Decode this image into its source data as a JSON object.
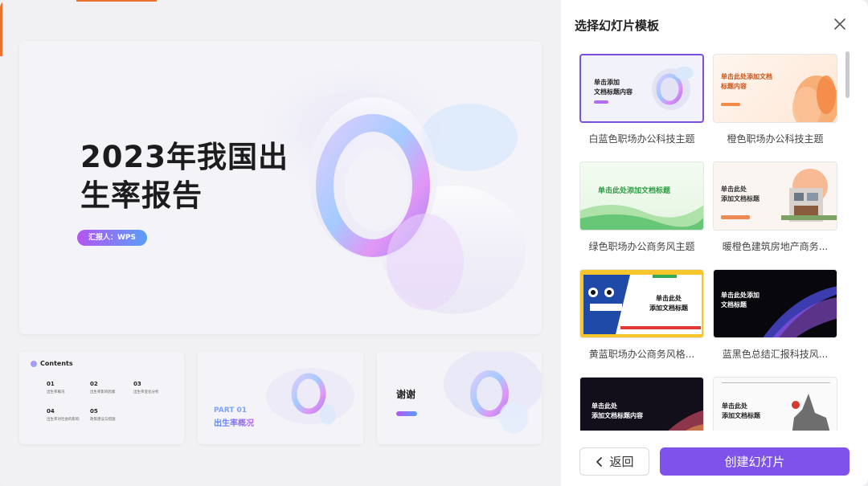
{
  "preview": {
    "main_title_line1": "2023年我国出",
    "main_title_line2": "生率报告",
    "reporter": "汇报人：WPS",
    "contents_title": "Contents",
    "contents_items": [
      {
        "num": "01",
        "label": "出生率概况"
      },
      {
        "num": "02",
        "label": "出生率影响因素"
      },
      {
        "num": "03",
        "label": "出生率变化分析"
      },
      {
        "num": "04",
        "label": "出生率对社会的影响"
      },
      {
        "num": "05",
        "label": "政策建议与措施"
      }
    ],
    "part_label": "PART 01",
    "part_title": "出生率概况",
    "thanks": "谢谢"
  },
  "panel": {
    "title": "选择幻灯片模板",
    "templates": [
      {
        "name": "白蓝色职场办公科技主题",
        "thumb_text": "单击添加\n文档标题内容",
        "selected": true
      },
      {
        "name": "橙色职场办公科技主题",
        "thumb_text": "单击此处添加文档\n标题内容",
        "selected": false
      },
      {
        "name": "绿色职场办公商务风主题",
        "thumb_text": "单击此处添加文档标题",
        "selected": false
      },
      {
        "name": "暖橙色建筑房地产商务...",
        "thumb_text": "单击此处\n添加文档标题",
        "selected": false
      },
      {
        "name": "黄蓝职场办公商务风格...",
        "thumb_text": "单击此处\n添加文档标题",
        "selected": false
      },
      {
        "name": "蓝黑色总结汇报科技风...",
        "thumb_text": "单击此处添加\n文档标题",
        "selected": false
      },
      {
        "name": "",
        "thumb_text": "单击此处\n添加文档标题内容",
        "selected": false
      },
      {
        "name": "",
        "thumb_text": "单击此处\n添加文档标题",
        "selected": false
      }
    ],
    "back_label": "返回",
    "create_label": "创建幻灯片"
  },
  "colors": {
    "accent": "#7f52eb",
    "selected_border": "#7b4fe0",
    "orange": "#e9722e"
  },
  "icons": [
    "close-icon",
    "chevron-left-icon",
    "ring-3d-icon"
  ]
}
